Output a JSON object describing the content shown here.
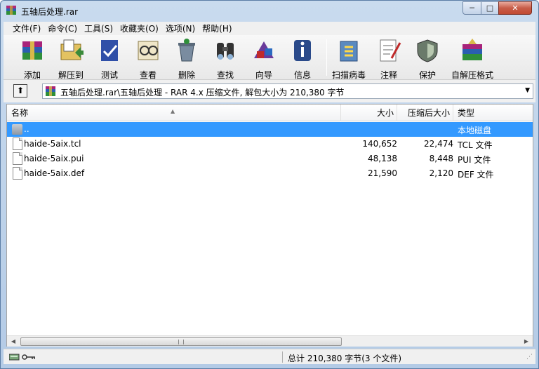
{
  "window": {
    "title": "五轴后处理.rar",
    "min_glyph": "─",
    "max_glyph": "□",
    "close_glyph": "✕"
  },
  "menu": [
    "文件(F)",
    "命令(C)",
    "工具(S)",
    "收藏夹(O)",
    "选项(N)",
    "帮助(H)"
  ],
  "toolbar": [
    {
      "label": "添加",
      "icon": "add-archive-icon"
    },
    {
      "label": "解压到",
      "icon": "extract-to-icon"
    },
    {
      "label": "测试",
      "icon": "test-icon"
    },
    {
      "label": "查看",
      "icon": "view-icon"
    },
    {
      "label": "删除",
      "icon": "delete-icon"
    },
    {
      "label": "查找",
      "icon": "find-icon"
    },
    {
      "label": "向导",
      "icon": "wizard-icon"
    },
    {
      "label": "信息",
      "icon": "info-icon"
    },
    {
      "label": "扫描病毒",
      "icon": "virus-scan-icon"
    },
    {
      "label": "注释",
      "icon": "comment-icon"
    },
    {
      "label": "保护",
      "icon": "protect-icon"
    },
    {
      "label": "自解压格式",
      "icon": "sfx-icon"
    }
  ],
  "address": {
    "up_glyph": "⬆",
    "path": "五轴后处理.rar\\五轴后处理 - RAR 4.x 压缩文件, 解包大小为 210,380 字节",
    "dropdown_glyph": "▼"
  },
  "columns": {
    "name": "名称",
    "size": "大小",
    "packed": "压缩后大小",
    "type": "类型",
    "sort_glyph": "▲"
  },
  "rows": [
    {
      "name": "..",
      "size": "",
      "packed": "",
      "type": "本地磁盘",
      "selected": true,
      "kind": "parent"
    },
    {
      "name": "haide-5aix.tcl",
      "size": "140,652",
      "packed": "22,474",
      "type": "TCL 文件",
      "selected": false,
      "kind": "file"
    },
    {
      "name": "haide-5aix.pui",
      "size": "48,138",
      "packed": "8,448",
      "type": "PUI 文件",
      "selected": false,
      "kind": "file"
    },
    {
      "name": "haide-5aix.def",
      "size": "21,590",
      "packed": "2,120",
      "type": "DEF 文件",
      "selected": false,
      "kind": "file"
    }
  ],
  "scroll": {
    "left_glyph": "◀",
    "right_glyph": "▶"
  },
  "status": {
    "summary": "总计 210,380 字节(3 个文件)",
    "grip_glyph": "⋰"
  },
  "colors": {
    "selection": "#3399ff",
    "title_bar": "#c9dbee"
  }
}
